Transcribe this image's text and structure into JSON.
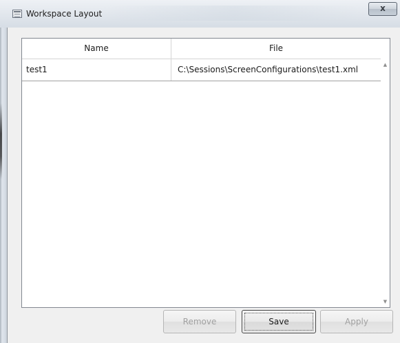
{
  "window": {
    "title": "Workspace Layout",
    "close_glyph": "x"
  },
  "table": {
    "columns": [
      "Name",
      "File"
    ],
    "rows": [
      {
        "name": "test1",
        "file": "C:\\Sessions\\ScreenConfigurations\\test1.xml"
      }
    ]
  },
  "scrollbar": {
    "up_glyph": "▲",
    "down_glyph": "▼"
  },
  "buttons": {
    "remove": "Remove",
    "save": "Save",
    "apply": "Apply"
  },
  "icons": {
    "app": "window-icon",
    "close": "close-icon"
  },
  "colors": {
    "titlebar": "#dfe5ec",
    "content_bg": "#f0f0f0",
    "disabled_text": "#a0a0a0"
  }
}
